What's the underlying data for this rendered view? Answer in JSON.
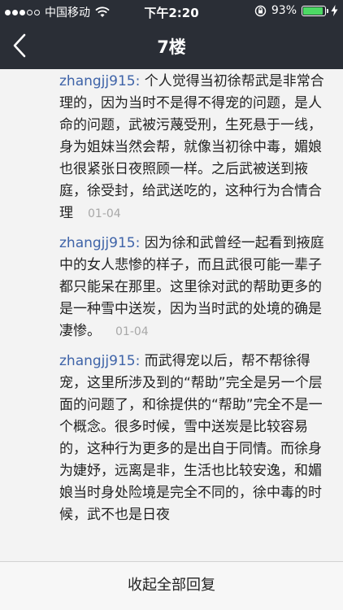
{
  "status_bar": {
    "carrier": "中国移动",
    "time": "下午2:20",
    "battery_percent": "93%",
    "battery_level": 0.93,
    "battery_color": "#4cd964"
  },
  "nav": {
    "title": "7楼",
    "back_icon": "chevron-left-icon"
  },
  "replies": [
    {
      "username": "zhangjj915",
      "text": " 个人觉得当初徐帮武是非常合理的，因为当时不是得不得宠的问题，是人命的问题，武被污蔑受刑，生死悬于一线，身为姐妹当然会帮，就像当初徐中毒，媚娘也很紧张日夜照顾一样。之后武被送到掖庭，徐受封，给武送吃的，这种行为合情合理",
      "date": "01-04"
    },
    {
      "username": "zhangjj915",
      "text": " 因为徐和武曾经一起看到掖庭中的女人悲惨的样子，而且武很可能一辈子都只能呆在那里。这里徐对武的帮助更多的是一种雪中送炭，因为当时武的处境的确是凄惨。",
      "date": "01-04"
    },
    {
      "username": "zhangjj915",
      "text": " 而武得宠以后，帮不帮徐得宠，这里所涉及到的“帮助”完全是另一个层面的问题了，和徐提供的“帮助”完全不是一个概念。很多时候，雪中送炭是比较容易的，这种行为更多的是出自于同情。而徐身为婕妤，远离是非，生活也比较安逸，和媚娘当时身处险境是完全不同的，徐中毒的时候，武不也是日夜",
      "date": ""
    }
  ],
  "bottom": {
    "collapse_label": "收起全部回复"
  },
  "colors": {
    "header_bg": "#2a2e36",
    "username": "#3e63a8",
    "date": "#a8a8a8",
    "content_bg": "#f3f3f3"
  }
}
